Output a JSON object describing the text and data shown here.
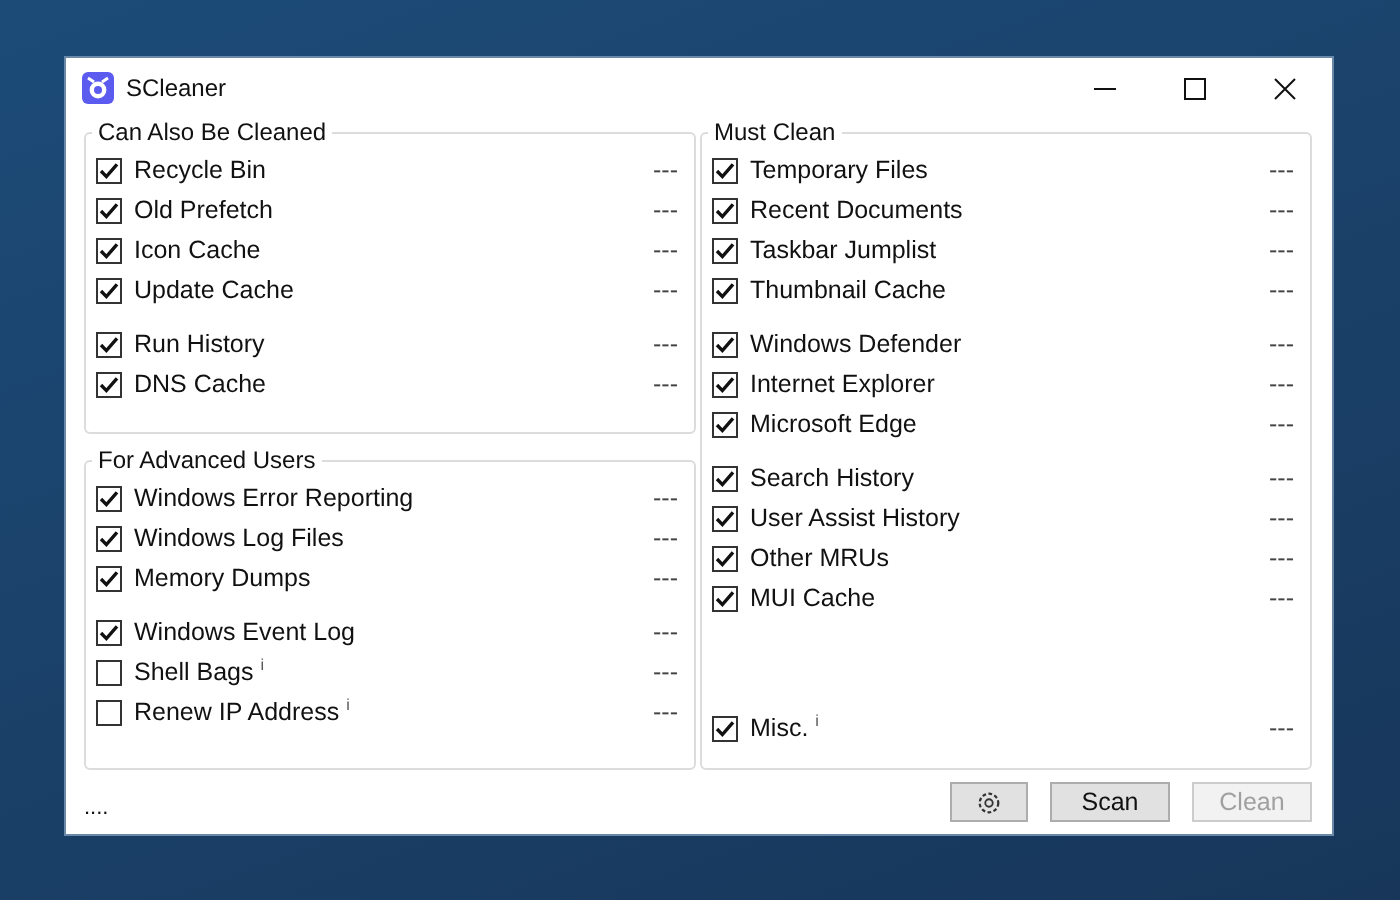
{
  "window": {
    "title": "SCleaner"
  },
  "groups": [
    {
      "title": "Can Also Be Cleaned",
      "sets": [
        [
          {
            "label": "Recycle Bin",
            "checked": true,
            "reading": "---"
          },
          {
            "label": "Old Prefetch",
            "checked": true,
            "reading": "---"
          },
          {
            "label": "Icon Cache",
            "checked": true,
            "reading": "---"
          },
          {
            "label": "Update Cache",
            "checked": true,
            "reading": "---"
          }
        ],
        [
          {
            "label": "Run History",
            "checked": true,
            "reading": "---"
          },
          {
            "label": "DNS Cache",
            "checked": true,
            "reading": "---"
          }
        ]
      ]
    },
    {
      "title": "For Advanced Users",
      "sets": [
        [
          {
            "label": "Windows Error Reporting",
            "checked": true,
            "reading": "---"
          },
          {
            "label": "Windows Log Files",
            "checked": true,
            "reading": "---"
          },
          {
            "label": "Memory Dumps",
            "checked": true,
            "reading": "---"
          }
        ],
        [
          {
            "label": "Windows Event Log",
            "checked": true,
            "reading": "---"
          },
          {
            "label": "Shell Bags $^{i}$",
            "checked": false,
            "reading": "---"
          },
          {
            "label": "Renew IP Address $^{i}$",
            "checked": false,
            "reading": "---"
          }
        ]
      ]
    },
    {
      "title": "Must Clean",
      "sets": [
        [
          {
            "label": "Temporary Files",
            "checked": true,
            "reading": "---"
          },
          {
            "label": "Recent Documents",
            "checked": true,
            "reading": "---"
          },
          {
            "label": "Taskbar Jumplist",
            "checked": true,
            "reading": "---"
          },
          {
            "label": "Thumbnail Cache",
            "checked": true,
            "reading": "---"
          }
        ],
        [
          {
            "label": "Windows Defender",
            "checked": true,
            "reading": "---"
          },
          {
            "label": "Internet Explorer",
            "checked": true,
            "reading": "---"
          },
          {
            "label": "Microsoft Edge",
            "checked": true,
            "reading": "---"
          }
        ],
        [
          {
            "label": "Search History",
            "checked": true,
            "reading": "---"
          },
          {
            "label": "User Assist History",
            "checked": true,
            "reading": "---"
          },
          {
            "label": "Other MRUs",
            "checked": true,
            "reading": "---"
          },
          {
            "label": "MUI Cache",
            "checked": true,
            "reading": "---"
          }
        ],
        [
          {
            "label": "Misc. $^{i}$",
            "checked": true,
            "reading": "---"
          }
        ]
      ]
    }
  ],
  "status": "....",
  "buttons": [
    {
      "kind": "settings",
      "disabled": false
    },
    {
      "kind": "text",
      "label": "Scan",
      "disabled": false
    },
    {
      "kind": "text",
      "label": "Clean",
      "disabled": true
    }
  ]
}
